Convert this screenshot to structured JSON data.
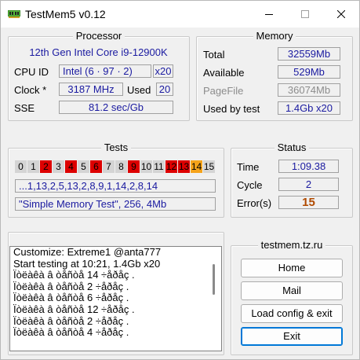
{
  "window": {
    "title": "TestMem5 v0.12",
    "controls": {
      "minimize": "–",
      "maximize": "☐",
      "close": "✕"
    }
  },
  "processor": {
    "title": "Processor",
    "name": "12th Gen Intel Core i9-12900K",
    "cpu_id_label": "CPU ID",
    "cpu_id_value": "Intel  (6 · 97 · 2)",
    "cpu_cores": "x20",
    "clock_label": "Clock *",
    "clock_value": "3187 MHz",
    "used_label": "Used",
    "used_value": "20",
    "sse_label": "SSE",
    "sse_value": "81.2 sec/Gb"
  },
  "memory": {
    "title": "Memory",
    "total_label": "Total",
    "total_value": "32559Mb",
    "available_label": "Available",
    "available_value": "529Mb",
    "pagefile_label": "PageFile",
    "pagefile_value": "36074Mb",
    "used_by_test_label": "Used by test",
    "used_by_test_value": "1.4Gb x20"
  },
  "tests": {
    "title": "Tests",
    "cells": [
      {
        "n": "0",
        "state": "idle"
      },
      {
        "n": "1",
        "state": "idle"
      },
      {
        "n": "2",
        "state": "done"
      },
      {
        "n": "3",
        "state": "idle"
      },
      {
        "n": "4",
        "state": "done"
      },
      {
        "n": "5",
        "state": "idle"
      },
      {
        "n": "6",
        "state": "done"
      },
      {
        "n": "7",
        "state": "idle"
      },
      {
        "n": "8",
        "state": "idle"
      },
      {
        "n": "9",
        "state": "done"
      },
      {
        "n": "10",
        "state": "idle"
      },
      {
        "n": "11",
        "state": "idle"
      },
      {
        "n": "12",
        "state": "done"
      },
      {
        "n": "13",
        "state": "done"
      },
      {
        "n": "14",
        "state": "current"
      },
      {
        "n": "15",
        "state": "idle"
      }
    ],
    "sequence": "...1,13,2,5,13,2,8,9,1,14,2,8,14",
    "current_test": "\"Simple Memory Test\", 256, 4Mb"
  },
  "status": {
    "title": "Status",
    "time_label": "Time",
    "time_value": "1:09.38",
    "cycle_label": "Cycle",
    "cycle_value": "2",
    "errors_label": "Error(s)",
    "errors_value": "15"
  },
  "log_lines": [
    "Customize: Extreme1 @anta777",
    "Start testing at 10:21, 1.4Gb x20",
    "Ïòëàêà â òåñòå 14 ÷åðåç .",
    "Ïòëàêà â òåñòå 2 ÷åðåç .",
    "Ïòëàêà â òåñòå 6 ÷åðåç .",
    "Ïòëàêà â òåñòå 12 ÷åðåç .",
    "Ïòëàêà â òåñòå 2 ÷åðåç .",
    "Ïòëàêà â òåñòå 4 ÷åðåç ."
  ],
  "side": {
    "title": "testmem.tz.ru",
    "home_label": "Home",
    "mail_label": "Mail",
    "load_label": "Load config & exit",
    "exit_label": "Exit"
  },
  "colors": {
    "done": "#dd0000",
    "current": "#f5a31a",
    "idle": "#d4d4d4",
    "value_text": "#1a1aa0",
    "errors_text": "#b04a00"
  }
}
